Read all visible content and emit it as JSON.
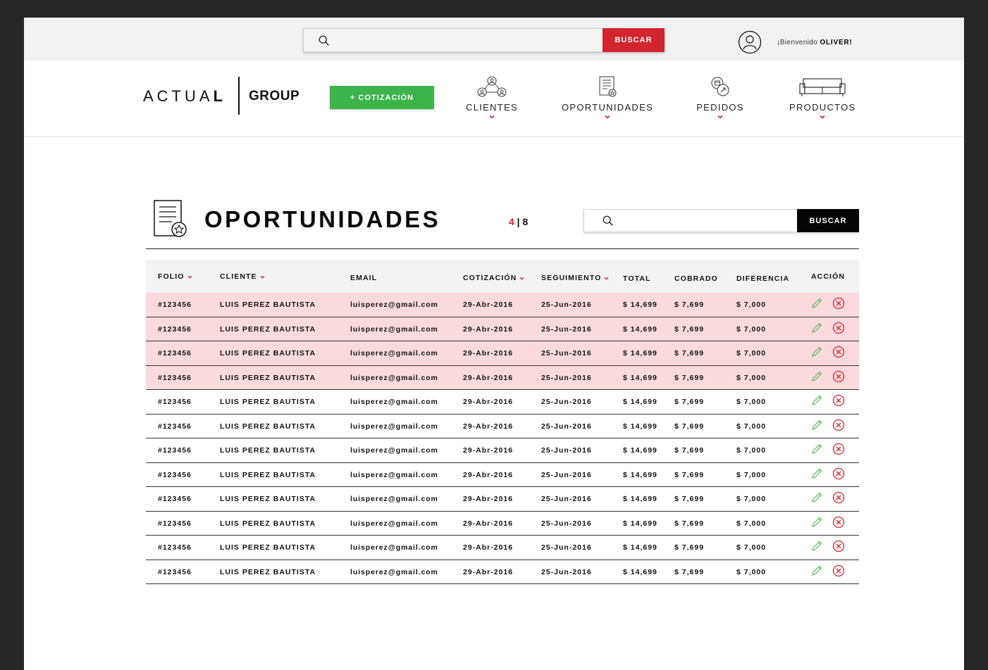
{
  "top_search": {
    "button_label": "BUSCAR",
    "placeholder": ""
  },
  "user": {
    "greeting": "¡Bienvenido",
    "name": "OLIVER!"
  },
  "logo": {
    "actual_prefix": "ACTUA",
    "actual_bold": "L",
    "group": "GROUP"
  },
  "cotizacion_button": "+ COTIZACIÓN",
  "nav": [
    {
      "label": "CLIENTES",
      "icon": "clients-network-icon"
    },
    {
      "label": "OPORTUNIDADES",
      "icon": "document-star-icon"
    },
    {
      "label": "PEDIDOS",
      "icon": "orders-icon"
    },
    {
      "label": "PRODUCTOS",
      "icon": "sofa-icon"
    }
  ],
  "section": {
    "title": "OPORTUNIDADES",
    "pager": {
      "current": "4",
      "separator": " | ",
      "total": "8"
    },
    "search_button": "BUSCAR",
    "search_placeholder": ""
  },
  "colors": {
    "accent_red": "#d3252f",
    "green": "#3bb44a",
    "row_highlight": "#fadadd"
  },
  "table": {
    "headers": [
      "FOLIO",
      "CLIENTE",
      "EMAIL",
      "COTIZACIÓN",
      "SEGUIMIENTO",
      "TOTAL",
      "COBRADO",
      "DIFERENCIA",
      "ACCIÓN"
    ],
    "rows": [
      {
        "folio": "#123456",
        "cliente": "LUIS PEREZ BAUTISTA",
        "email": "luisperez@gmail.com",
        "cotizacion": "29-Abr-2016",
        "seguimiento": "25-Jun-2016",
        "total": "$ 14,699",
        "cobrado": "$ 7,699",
        "diferencia": "$ 7,000",
        "highlighted": true
      },
      {
        "folio": "#123456",
        "cliente": "LUIS PEREZ BAUTISTA",
        "email": "luisperez@gmail.com",
        "cotizacion": "29-Abr-2016",
        "seguimiento": "25-Jun-2016",
        "total": "$ 14,699",
        "cobrado": "$ 7,699",
        "diferencia": "$ 7,000",
        "highlighted": true
      },
      {
        "folio": "#123456",
        "cliente": "LUIS PEREZ BAUTISTA",
        "email": "luisperez@gmail.com",
        "cotizacion": "29-Abr-2016",
        "seguimiento": "25-Jun-2016",
        "total": "$ 14,699",
        "cobrado": "$ 7,699",
        "diferencia": "$ 7,000",
        "highlighted": true
      },
      {
        "folio": "#123456",
        "cliente": "LUIS PEREZ BAUTISTA",
        "email": "luisperez@gmail.com",
        "cotizacion": "29-Abr-2016",
        "seguimiento": "25-Jun-2016",
        "total": "$ 14,699",
        "cobrado": "$ 7,699",
        "diferencia": "$ 7,000",
        "highlighted": true
      },
      {
        "folio": "#123456",
        "cliente": "LUIS PEREZ BAUTISTA",
        "email": "luisperez@gmail.com",
        "cotizacion": "29-Abr-2016",
        "seguimiento": "25-Jun-2016",
        "total": "$ 14,699",
        "cobrado": "$ 7,699",
        "diferencia": "$ 7,000",
        "highlighted": false
      },
      {
        "folio": "#123456",
        "cliente": "LUIS PEREZ BAUTISTA",
        "email": "luisperez@gmail.com",
        "cotizacion": "29-Abr-2016",
        "seguimiento": "25-Jun-2016",
        "total": "$ 14,699",
        "cobrado": "$ 7,699",
        "diferencia": "$ 7,000",
        "highlighted": false
      },
      {
        "folio": "#123456",
        "cliente": "LUIS PEREZ BAUTISTA",
        "email": "luisperez@gmail.com",
        "cotizacion": "29-Abr-2016",
        "seguimiento": "25-Jun-2016",
        "total": "$ 14,699",
        "cobrado": "$ 7,699",
        "diferencia": "$ 7,000",
        "highlighted": false
      },
      {
        "folio": "#123456",
        "cliente": "LUIS PEREZ BAUTISTA",
        "email": "luisperez@gmail.com",
        "cotizacion": "29-Abr-2016",
        "seguimiento": "25-Jun-2016",
        "total": "$ 14,699",
        "cobrado": "$ 7,699",
        "diferencia": "$ 7,000",
        "highlighted": false
      },
      {
        "folio": "#123456",
        "cliente": "LUIS PEREZ BAUTISTA",
        "email": "luisperez@gmail.com",
        "cotizacion": "29-Abr-2016",
        "seguimiento": "25-Jun-2016",
        "total": "$ 14,699",
        "cobrado": "$ 7,699",
        "diferencia": "$ 7,000",
        "highlighted": false
      },
      {
        "folio": "#123456",
        "cliente": "LUIS PEREZ BAUTISTA",
        "email": "luisperez@gmail.com",
        "cotizacion": "29-Abr-2016",
        "seguimiento": "25-Jun-2016",
        "total": "$ 14,699",
        "cobrado": "$ 7,699",
        "diferencia": "$ 7,000",
        "highlighted": false
      },
      {
        "folio": "#123456",
        "cliente": "LUIS PEREZ BAUTISTA",
        "email": "luisperez@gmail.com",
        "cotizacion": "29-Abr-2016",
        "seguimiento": "25-Jun-2016",
        "total": "$ 14,699",
        "cobrado": "$ 7,699",
        "diferencia": "$ 7,000",
        "highlighted": false
      },
      {
        "folio": "#123456",
        "cliente": "LUIS PEREZ BAUTISTA",
        "email": "luisperez@gmail.com",
        "cotizacion": "29-Abr-2016",
        "seguimiento": "25-Jun-2016",
        "total": "$ 14,699",
        "cobrado": "$ 7,699",
        "diferencia": "$ 7,000",
        "highlighted": false
      }
    ]
  }
}
